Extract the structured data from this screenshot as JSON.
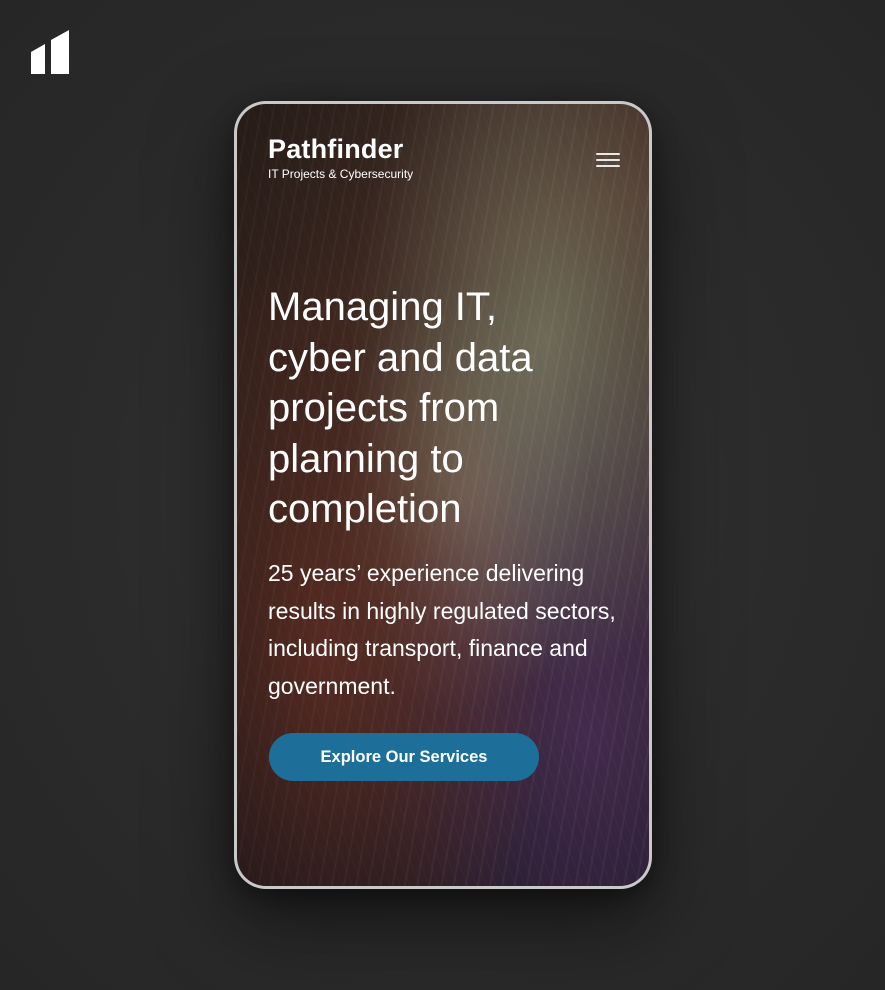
{
  "brand": {
    "mark_icon": "bookmark-logo-icon",
    "mark_color": "#ffffff"
  },
  "header": {
    "logo_title": "Pathfinder",
    "logo_subtitle": "IT Projects & Cybersecurity",
    "menu_icon": "hamburger-menu-icon"
  },
  "hero": {
    "heading": "Managing IT, cyber and data projects from planning to completion",
    "description": "25 years’ experience delivering results in highly regulated sectors, including transport, finance and government.",
    "cta_label": "Explore Our Services"
  },
  "colors": {
    "page_background": "#2b2b2b",
    "cta_background": "#1d6f9a",
    "text": "#ffffff"
  }
}
